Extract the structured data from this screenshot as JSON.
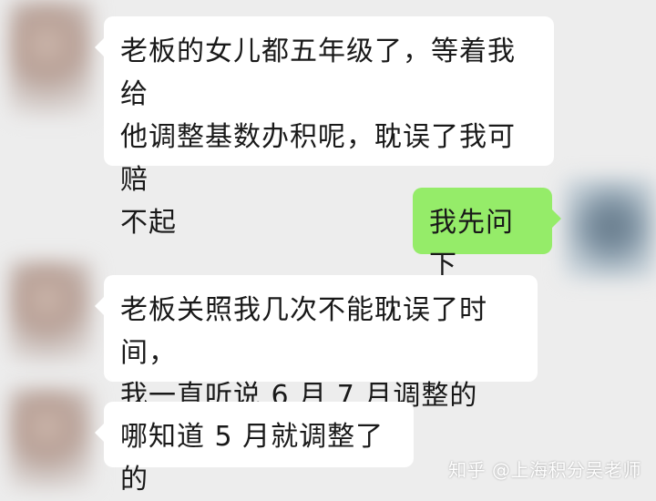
{
  "chat": {
    "messages": [
      {
        "side": "left",
        "lines": [
          "老板的女儿都五年级了，等着我给",
          "他调整基数办积呢，耽误了我可赔",
          "不起"
        ]
      },
      {
        "side": "right",
        "lines": [
          "我先问下"
        ]
      },
      {
        "side": "left",
        "lines": [
          "老板关照我几次不能耽误了时间，",
          "我一直听说 6 月 7 月调整的"
        ]
      },
      {
        "side": "left",
        "lines": [
          "哪知道 5 月就调整了的"
        ]
      }
    ]
  },
  "watermark": {
    "text": "知乎 @上海积分吴老师"
  }
}
